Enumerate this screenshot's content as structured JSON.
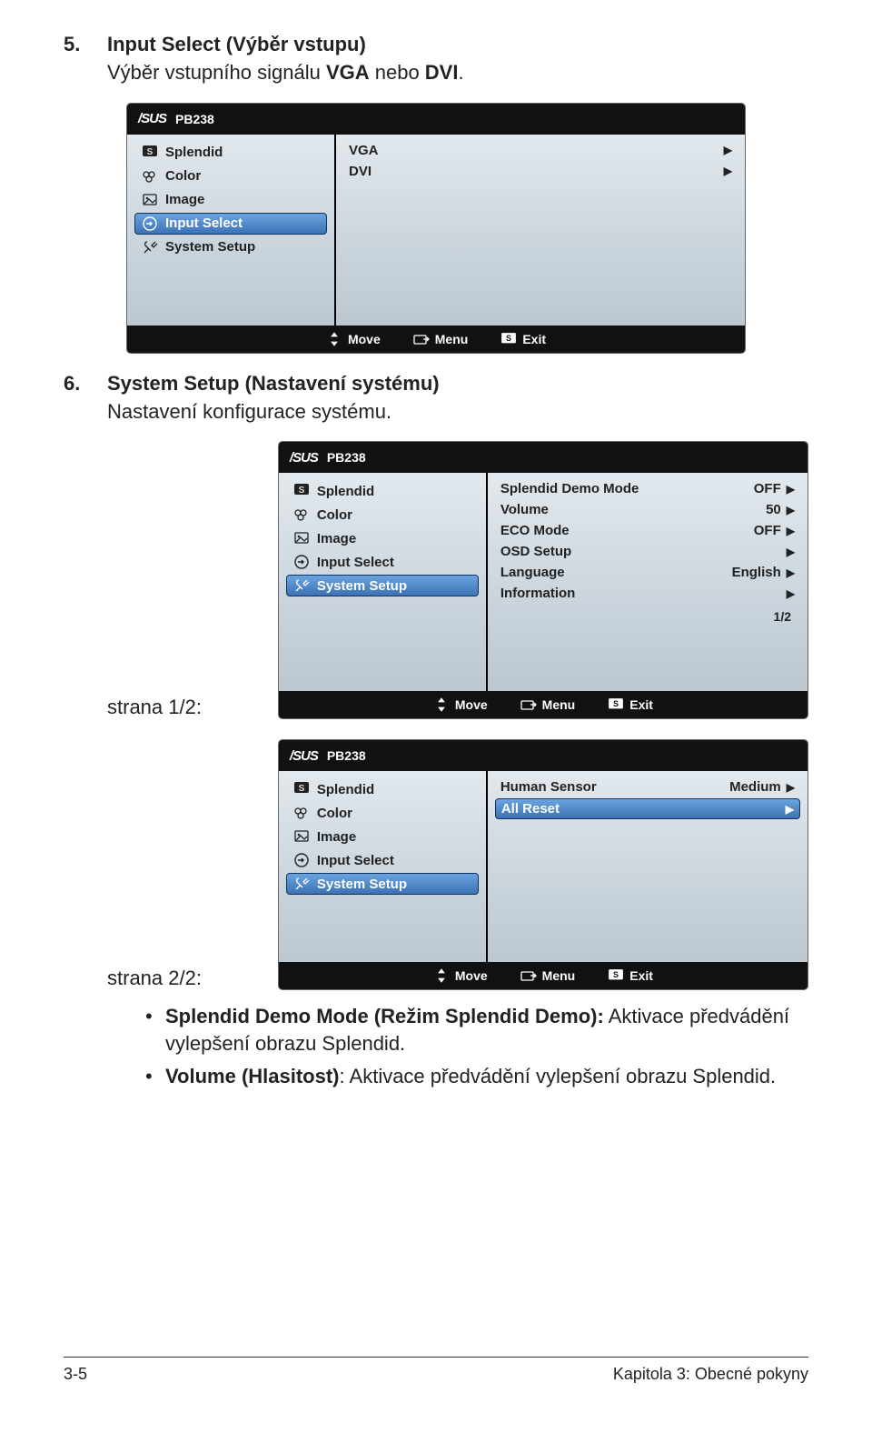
{
  "sections": {
    "s5": {
      "num": "5.",
      "title": "Input Select (Výběr vstupu)",
      "desc_pre": "Výběr vstupního signálu ",
      "desc_bold1": "VGA",
      "desc_mid": " nebo ",
      "desc_bold2": "DVI",
      "desc_end": "."
    },
    "s6": {
      "num": "6.",
      "title": "System Setup (Nastavení systému)",
      "desc": "Nastavení konfigurace systému."
    }
  },
  "logo": "/SUS",
  "model": "PB238",
  "nav": {
    "splendid": "Splendid",
    "color": "Color",
    "image": "Image",
    "input": "Input Select",
    "system": "System Setup"
  },
  "osd1": {
    "items": [
      {
        "label": "VGA"
      },
      {
        "label": "DVI"
      }
    ]
  },
  "osd2": {
    "items": [
      {
        "label": "Splendid Demo Mode",
        "val": "OFF"
      },
      {
        "label": "Volume",
        "val": "50"
      },
      {
        "label": "ECO Mode",
        "val": "OFF"
      },
      {
        "label": "OSD Setup",
        "val": ""
      },
      {
        "label": "Language",
        "val": "English"
      },
      {
        "label": "Information",
        "val": ""
      }
    ],
    "page": "1/2"
  },
  "osd3": {
    "items": [
      {
        "label": "Human Sensor",
        "val": "Medium",
        "sel": false
      },
      {
        "label": "All Reset",
        "val": "",
        "sel": true
      }
    ]
  },
  "footer": {
    "move": "Move",
    "menu": "Menu",
    "exit": "Exit"
  },
  "strana": {
    "p1": "strana 1/2:",
    "p2": "strana 2/2:"
  },
  "bullets": [
    {
      "b": "Splendid Demo Mode (Režim Splendid Demo):",
      "t": " Aktivace předvádění vylepšení obrazu Splendid."
    },
    {
      "b": "Volume (Hlasitost)",
      "t": ": Aktivace předvádění vylepšení obrazu Splendid."
    }
  ],
  "pagefoot": {
    "left": "3-5",
    "right": "Kapitola 3: Obecné pokyny"
  }
}
